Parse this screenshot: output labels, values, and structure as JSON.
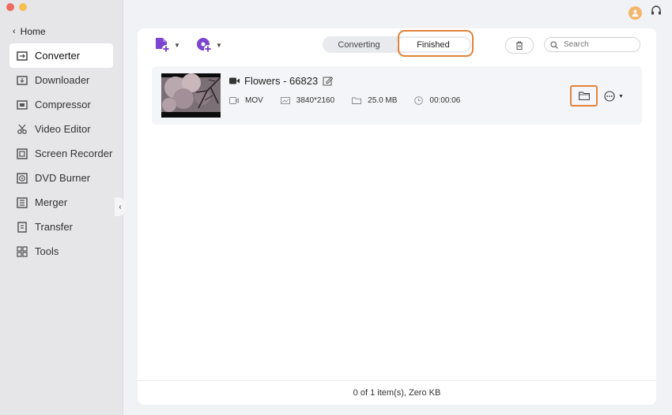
{
  "sidebar": {
    "home_label": "Home",
    "items": [
      {
        "label": "Converter",
        "icon": "converter-icon",
        "active": true
      },
      {
        "label": "Downloader",
        "icon": "downloader-icon"
      },
      {
        "label": "Compressor",
        "icon": "compressor-icon"
      },
      {
        "label": "Video Editor",
        "icon": "video-editor-icon"
      },
      {
        "label": "Screen Recorder",
        "icon": "screen-recorder-icon"
      },
      {
        "label": "DVD Burner",
        "icon": "dvd-burner-icon"
      },
      {
        "label": "Merger",
        "icon": "merger-icon"
      },
      {
        "label": "Transfer",
        "icon": "transfer-icon"
      },
      {
        "label": "Tools",
        "icon": "tools-icon"
      }
    ]
  },
  "tabs": {
    "converting": "Converting",
    "finished": "Finished",
    "active": "Finished"
  },
  "search": {
    "placeholder": "Search"
  },
  "file": {
    "name": "Flowers - 66823",
    "format": "MOV",
    "resolution": "3840*2160",
    "size": "25.0 MB",
    "duration": "00:00:06"
  },
  "footer": {
    "status": "0 of 1 item(s), Zero KB"
  },
  "colors": {
    "accent": "#7b45cf",
    "highlight": "#e3833a",
    "avatar": "#f4b46c"
  }
}
